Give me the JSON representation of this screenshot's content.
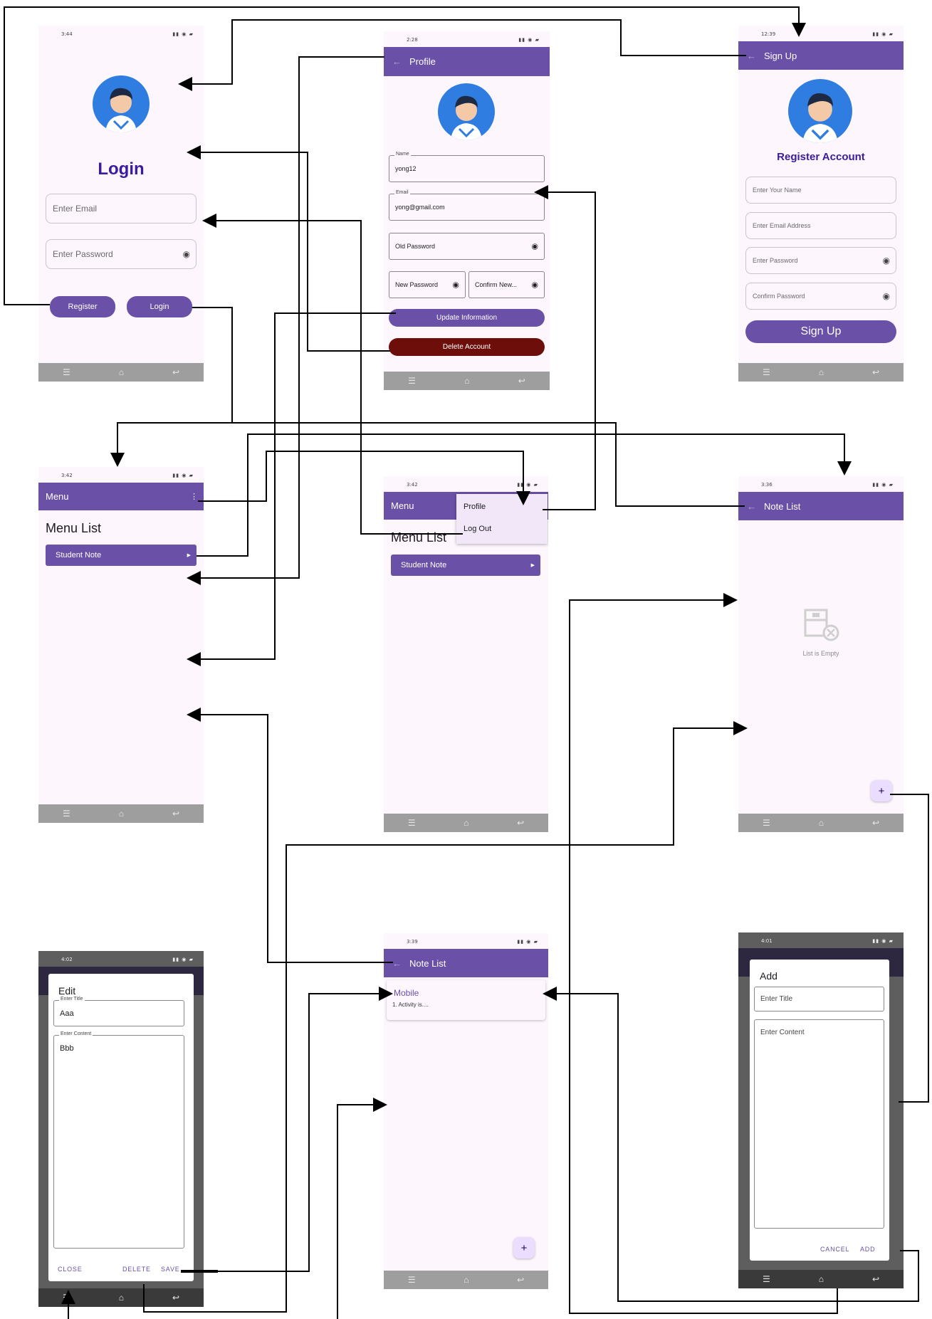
{
  "colors": {
    "primary": "#6a50a7",
    "danger": "#6e0e0a",
    "background": "#fdf7fd",
    "navbar": "#9e9e9e"
  },
  "login": {
    "time": "3:44",
    "title": "Login",
    "email_placeholder": "Enter Email",
    "password_placeholder": "Enter Password",
    "register_label": "Register",
    "login_label": "Login"
  },
  "profile": {
    "time": "2:28",
    "appbar_title": "Profile",
    "name_label": "Name",
    "name_value": "yong12",
    "email_label": "Email",
    "email_value": "yong@gmail.com",
    "old_password": "Old Password",
    "new_password": "New Password",
    "confirm_password": "Confirm New...",
    "update_label": "Update Information",
    "delete_label": "Delete Account"
  },
  "signup": {
    "time": "12:39",
    "appbar_title": "Sign Up",
    "heading": "Register Account",
    "name_placeholder": "Enter Your Name",
    "email_placeholder": "Enter Email Address",
    "password_placeholder": "Enter Password",
    "confirm_placeholder": "Confirm Password",
    "button_label": "Sign Up"
  },
  "menu": {
    "time": "3:42",
    "appbar_title": "Menu",
    "heading": "Menu List",
    "item_label": "Student Note"
  },
  "menu_popup": {
    "time": "3:42",
    "appbar_title": "Menu",
    "heading": "Menu List",
    "item_label": "Student Note",
    "popup_items": [
      "Profile",
      "Log Out"
    ]
  },
  "note_empty": {
    "time": "3:36",
    "appbar_title": "Note List",
    "empty_text": "List is Empty",
    "fab_icon": "plus-icon"
  },
  "edit_dialog": {
    "time": "4:02",
    "title": "Edit",
    "title_label": "Enter Title",
    "title_value": "Aaa",
    "content_label": "Enter Content",
    "content_value": "Bbb",
    "close_label": "CLOSE",
    "delete_label": "DELETE",
    "save_label": "SAVE"
  },
  "note_list": {
    "time": "3:39",
    "appbar_title": "Note List",
    "note_title": "Mobile",
    "note_preview": "1. Activity is....",
    "fab_icon": "plus-icon"
  },
  "add_dialog": {
    "time": "4:01",
    "title": "Add",
    "title_placeholder": "Enter Title",
    "content_placeholder": "Enter Content",
    "cancel_label": "CANCEL",
    "add_label": "ADD"
  }
}
